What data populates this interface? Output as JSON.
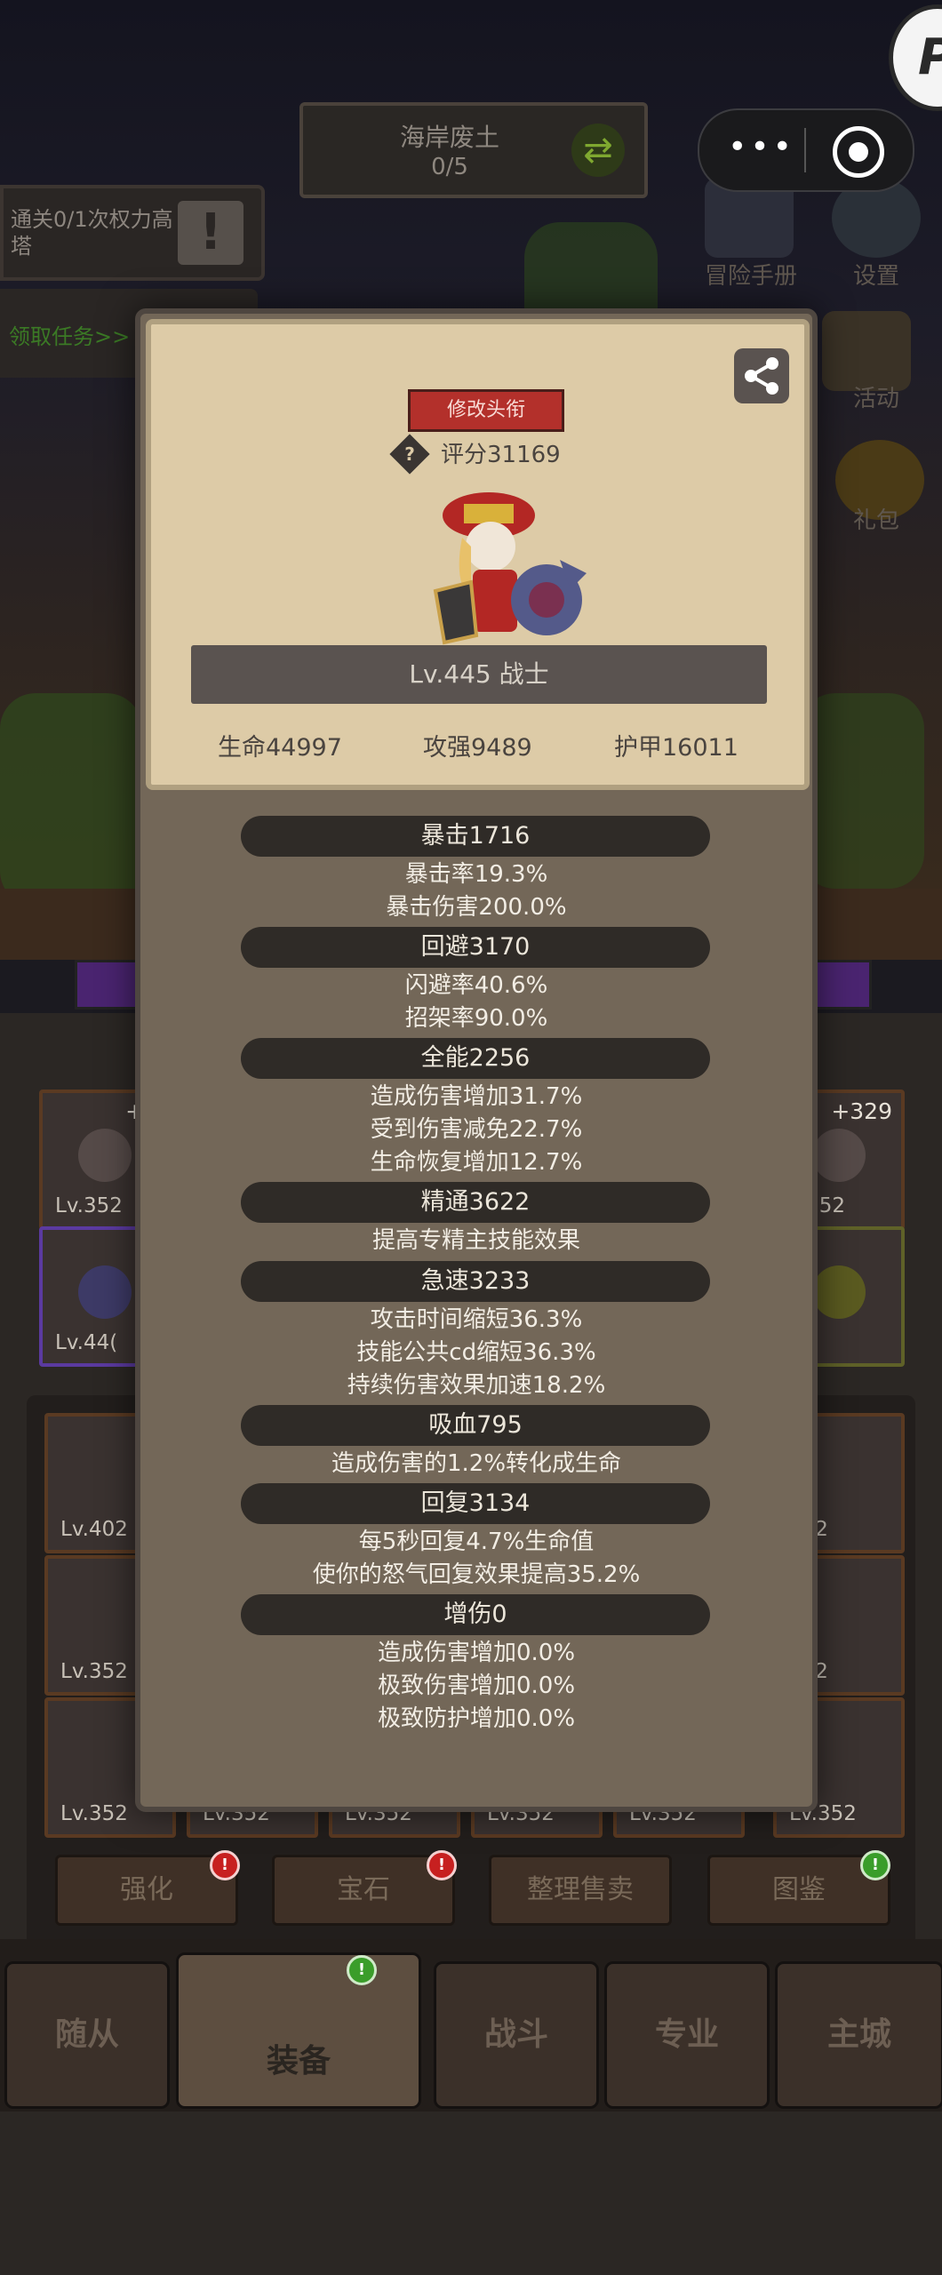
{
  "hud": {
    "area_name": "海岸废土",
    "area_progress": "0/5",
    "task_text": "通关0/1次权力高塔",
    "task_alert": "!",
    "claim_task": "领取任务>>",
    "adventure_label": "冒险手册",
    "settings_label": "设置",
    "events_label": "活动",
    "gift_label": "礼包",
    "capsule_dots": "•••"
  },
  "modal": {
    "title_button": "修改头衔",
    "help_glyph": "?",
    "score": "评分31169",
    "level_class": "Lv.445 战士",
    "base_stats": [
      "生命44997",
      "攻强9489",
      "护甲16011"
    ],
    "sections": [
      {
        "header": "暴击1716",
        "lines": [
          "暴击率19.3%",
          "暴击伤害200.0%"
        ]
      },
      {
        "header": "回避3170",
        "lines": [
          "闪避率40.6%",
          "招架率90.0%"
        ]
      },
      {
        "header": "全能2256",
        "lines": [
          "造成伤害增加31.7%",
          "受到伤害减免22.7%",
          "生命恢复增加12.7%"
        ]
      },
      {
        "header": "精通3622",
        "lines": [
          "提高专精主技能效果"
        ]
      },
      {
        "header": "急速3233",
        "lines": [
          "攻击时间缩短36.3%",
          "技能公共cd缩短36.3%",
          "持续伤害效果加速18.2%"
        ]
      },
      {
        "header": "吸血795",
        "lines": [
          "造成伤害的1.2%转化成生命"
        ]
      },
      {
        "header": "回复3134",
        "lines": [
          "每5秒回复4.7%生命值",
          "使你的怒气回复效果提高35.2%"
        ]
      },
      {
        "header": "增伤0",
        "lines": [
          "造成伤害增加0.0%",
          "极致伤害增加0.0%",
          "极致防护增加0.0%"
        ]
      }
    ]
  },
  "equipment": {
    "top_slots": [
      {
        "plus": "+3",
        "level": "Lv.352"
      },
      {
        "plus": "+329",
        "level": "v.352"
      }
    ],
    "mid_slots": [
      {
        "level": "Lv.44("
      }
    ],
    "grid_levels": [
      "Lv.402",
      "352",
      "Lv.352",
      "352",
      "Lv.352",
      "Lv.352",
      "Lv.352",
      "Lv.352",
      "Lv.352",
      "Lv.352"
    ]
  },
  "actions": [
    "强化",
    "宝石",
    "整理售卖",
    "图鉴"
  ],
  "action_badges": [
    "!",
    "!",
    "",
    "!"
  ],
  "tabs": [
    "随从",
    "装备",
    "战斗",
    "专业",
    "主城"
  ],
  "tab_badge": "!"
}
